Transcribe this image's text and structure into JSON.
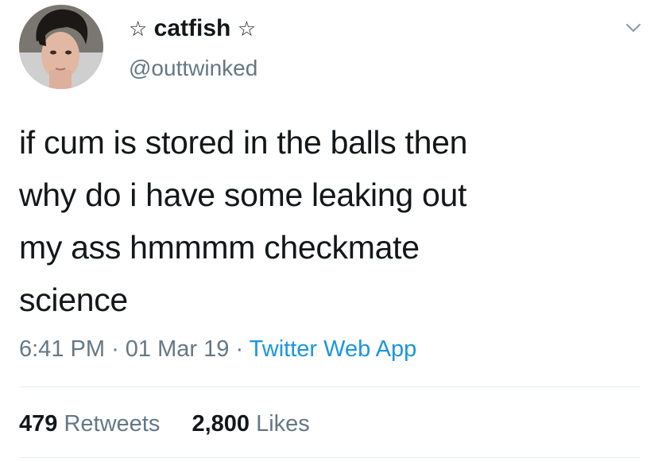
{
  "user": {
    "name": "catfish",
    "star_left": "☆",
    "star_right": "☆",
    "handle": "@outtwinked"
  },
  "tweet": {
    "lines": [
      "if cum is stored in the balls then",
      "why do i have some leaking out",
      "my ass hmmmm checkmate",
      "science"
    ]
  },
  "meta": {
    "time": "6:41 PM",
    "separator": "·",
    "date": "01 Mar 19",
    "source": "Twitter Web App"
  },
  "stats": {
    "retweets_count": "479",
    "retweets_label": "Retweets",
    "likes_count": "2,800",
    "likes_label": "Likes"
  },
  "icons": {
    "caret": "chevron-down-icon"
  },
  "colors": {
    "text": "#14171a",
    "secondary": "#657786",
    "link": "#1b95e0",
    "divider": "#e6ecf0"
  }
}
